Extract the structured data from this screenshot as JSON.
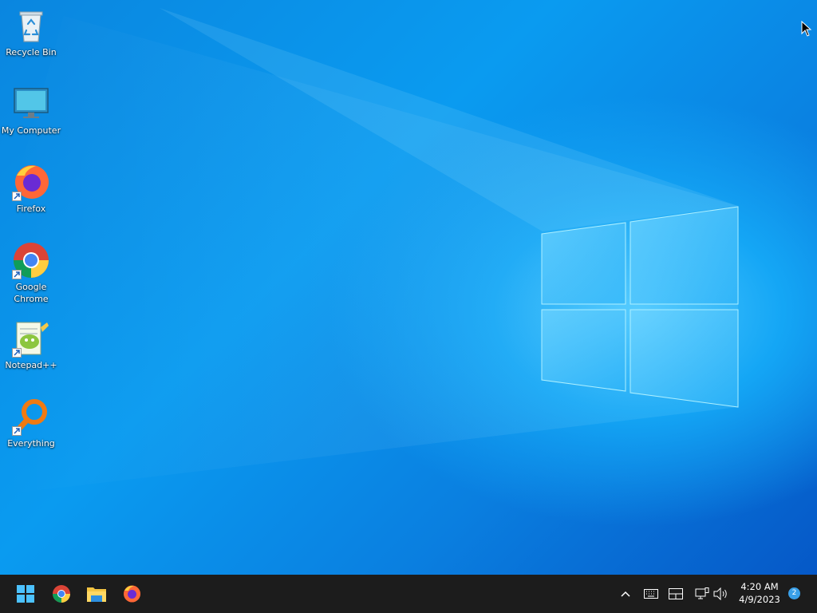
{
  "desktop": {
    "icons": [
      {
        "label": "Recycle Bin",
        "icon": "recycle-bin-icon"
      },
      {
        "label": "My Computer",
        "icon": "monitor-icon"
      },
      {
        "label": "Firefox",
        "icon": "firefox-icon"
      },
      {
        "label": "Google Chrome",
        "icon": "chrome-icon"
      },
      {
        "label": "Notepad++",
        "icon": "notepadpp-icon"
      },
      {
        "label": "Everything",
        "icon": "everything-search-icon"
      }
    ]
  },
  "taskbar": {
    "pinned": [
      {
        "icon": "windows-start-icon"
      },
      {
        "icon": "chrome-icon"
      },
      {
        "icon": "file-explorer-icon"
      },
      {
        "icon": "firefox-icon"
      }
    ],
    "tray": [
      {
        "icon": "chevron-up-icon"
      },
      {
        "icon": "keyboard-icon"
      },
      {
        "icon": "tablet-mode-icon"
      },
      {
        "icon": "network-icon"
      },
      {
        "icon": "volume-icon"
      }
    ],
    "clock": {
      "time": "4:20 AM",
      "date": "4/9/2023"
    },
    "notification_count": "2"
  },
  "colors": {
    "wallpaper": "#0a8fe8",
    "taskbar": "#1c1c1c",
    "accent": "#3aa0e8"
  }
}
